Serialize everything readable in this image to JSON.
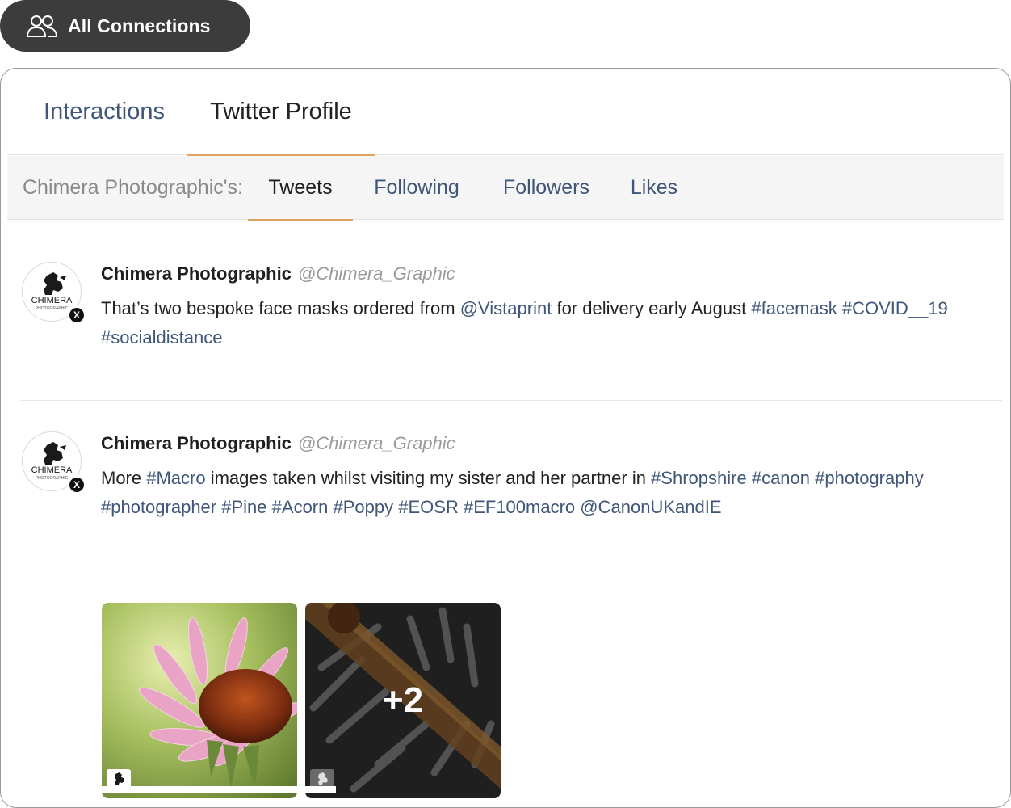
{
  "top_button": {
    "label": "All Connections",
    "icon": "users-icon"
  },
  "main_tabs": [
    {
      "label": "Interactions",
      "active": false
    },
    {
      "label": "Twitter Profile",
      "active": true
    }
  ],
  "sub_tabs": {
    "prefix": "Chimera Photographic's:",
    "items": [
      {
        "label": "Tweets",
        "active": true
      },
      {
        "label": "Following",
        "active": false
      },
      {
        "label": "Followers",
        "active": false
      },
      {
        "label": "Likes",
        "active": false
      }
    ]
  },
  "tweets": [
    {
      "author": "Chimera Photographic",
      "handle": "@Chimera_Graphic",
      "platform_badge": "X",
      "text": [
        {
          "t": "That’s two bespoke face masks ordered from ",
          "link": false
        },
        {
          "t": "@Vistaprint",
          "link": true
        },
        {
          "t": " for delivery early August ",
          "link": false
        },
        {
          "t": "#facemask",
          "link": true
        },
        {
          "t": " ",
          "link": false
        },
        {
          "t": "#COVID__19",
          "link": true
        },
        {
          "t": " ",
          "link": false
        },
        {
          "t": "#socialdistance",
          "link": true
        }
      ]
    },
    {
      "author": "Chimera Photographic",
      "handle": "@Chimera_Graphic",
      "platform_badge": "X",
      "text": [
        {
          "t": "More ",
          "link": false
        },
        {
          "t": "#Macro",
          "link": true
        },
        {
          "t": " images taken whilst visiting my sister and her partner in ",
          "link": false
        },
        {
          "t": "#Shropshire",
          "link": true
        },
        {
          "t": " ",
          "link": false
        },
        {
          "t": "#canon",
          "link": true
        },
        {
          "t": " ",
          "link": false
        },
        {
          "t": "#photography",
          "link": true
        },
        {
          "t": " ",
          "link": false
        },
        {
          "t": "#photographer",
          "link": true
        },
        {
          "t": " ",
          "link": false
        },
        {
          "t": "#Pine",
          "link": true
        },
        {
          "t": " ",
          "link": false
        },
        {
          "t": "#Acorn",
          "link": true
        },
        {
          "t": " ",
          "link": false
        },
        {
          "t": "#Poppy",
          "link": true
        },
        {
          "t": " ",
          "link": false
        },
        {
          "t": "#EOSR",
          "link": true
        },
        {
          "t": " ",
          "link": false
        },
        {
          "t": "#EF100macro",
          "link": true
        },
        {
          "t": " ",
          "link": false
        },
        {
          "t": "@CanonUKandIE",
          "link": true
        }
      ],
      "media_more_count": "+2"
    }
  ],
  "colors": {
    "link": "#3f5579",
    "accent_underline": "#e0a360",
    "pill_bg": "#3c3c3c"
  }
}
